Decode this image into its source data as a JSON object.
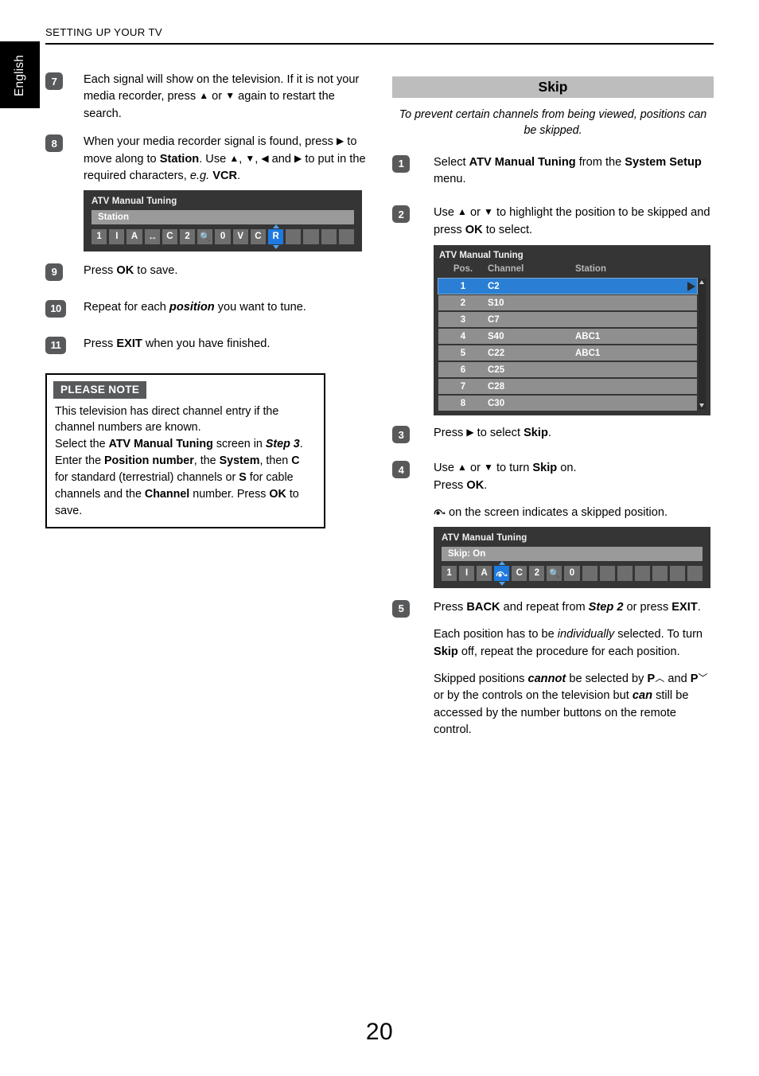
{
  "header": {
    "title": "SETTING UP YOUR TV"
  },
  "sidebar": {
    "language_tab": "English"
  },
  "page": {
    "number": "20"
  },
  "left_column": {
    "steps": [
      {
        "num": "7",
        "text": "Each signal will show on the television. If it is not your media recorder, press ▲ or ▼ again to restart the search."
      },
      {
        "num": "8",
        "text": "When your media recorder signal is found, press ▶ to move along to Station. Use ▲, ▼, ◀ and ▶ to put in the required characters, e.g. VCR."
      },
      {
        "num": "9",
        "text": "Press OK to save."
      },
      {
        "num": "10",
        "text": "Repeat for each position you want to tune."
      },
      {
        "num": "11",
        "text": "Press EXIT when you have finished."
      }
    ],
    "osd_station": {
      "title": "ATV Manual Tuning",
      "field_label": "Station",
      "cells": [
        "1",
        "I",
        "A",
        "left-right-arrow-icon",
        "C",
        "2",
        "magnifier-icon",
        "0",
        "V",
        "C",
        "R",
        "",
        "",
        "",
        ""
      ],
      "selected_index": 10,
      "selected_value": "R"
    },
    "note": {
      "heading": "PLEASE NOTE",
      "body": "This television has direct channel entry if the channel numbers are known.\nSelect the ATV Manual Tuning screen in Step 3.\nEnter the Position number, the System, then C for standard (terrestrial) channels or S for cable channels and the Channel number. Press OK to save."
    }
  },
  "right_column": {
    "section_title": "Skip",
    "section_subtitle": "To prevent certain channels from being viewed, positions can be skipped.",
    "steps": [
      {
        "num": "1",
        "text": "Select ATV Manual Tuning from the System Setup menu."
      },
      {
        "num": "2",
        "text": "Use ▲ or ▼ to highlight the position to be skipped and press OK to select."
      },
      {
        "num": "3",
        "text": "Press ▶ to select Skip."
      },
      {
        "num": "4",
        "text": "Use ▲ or ▼ to turn Skip on.\nPress OK.\n↪ on the screen indicates a skipped position."
      },
      {
        "num": "5",
        "text": "Press BACK and repeat from Step 2 or press EXIT.\nEach position has to be individually selected. To turn Skip off, repeat the procedure for each position.\nSkipped positions cannot be selected by P∧ and P∨ or by the controls on the television but can still be accessed by the number buttons on the remote control."
      }
    ],
    "channel_table": {
      "title": "ATV Manual Tuning",
      "columns": [
        "Pos.",
        "Channel",
        "Station"
      ],
      "rows": [
        {
          "pos": "1",
          "channel": "C2",
          "station": "",
          "selected": true
        },
        {
          "pos": "2",
          "channel": "S10",
          "station": "",
          "selected": false
        },
        {
          "pos": "3",
          "channel": "C7",
          "station": "",
          "selected": false
        },
        {
          "pos": "4",
          "channel": "S40",
          "station": "ABC1",
          "selected": false
        },
        {
          "pos": "5",
          "channel": "C22",
          "station": "ABC1",
          "selected": false
        },
        {
          "pos": "6",
          "channel": "C25",
          "station": "",
          "selected": false
        },
        {
          "pos": "7",
          "channel": "C28",
          "station": "",
          "selected": false
        },
        {
          "pos": "8",
          "channel": "C30",
          "station": "",
          "selected": false
        }
      ]
    },
    "osd_skip": {
      "title": "ATV Manual Tuning",
      "field_label": "Skip: On",
      "cells": [
        "1",
        "I",
        "A",
        "skip-icon",
        "C",
        "2",
        "magnifier-icon",
        "0",
        "",
        "",
        "",
        "",
        "",
        "",
        ""
      ],
      "selected_index": 3
    }
  },
  "colors": {
    "osd_background": "#353535",
    "osd_field": "#9a9a9a",
    "cell": "#6e6e6e",
    "cell_selected": "#1f7ae0",
    "row": "#8f8f8f",
    "row_selected": "#2a7fd4",
    "section_bar": "#bdbdbd",
    "bullet": "#58595b",
    "tab": "#000000"
  }
}
